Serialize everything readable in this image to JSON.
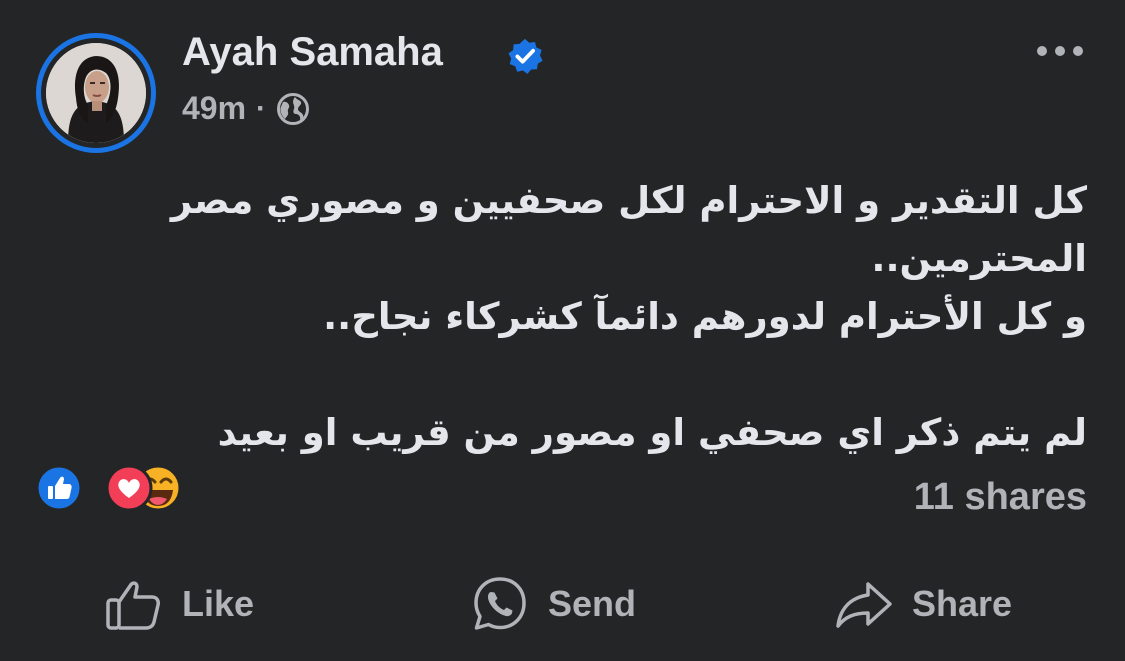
{
  "post": {
    "author": "Ayah Samaha",
    "verified": true,
    "time": "49m",
    "separator": "·",
    "audience_icon": "globe-icon",
    "more_icon": "more-horizontal-icon",
    "text_lines": [
      "كل التقدير و الاحترام لكل صحفيين و مصوري مصر المحترمين..",
      "و كل الأحترام لدورهم دائمآ كشركاء نجاح..",
      "",
      "لم يتم ذكر اي صحفي او مصور من قريب او بعيد"
    ]
  },
  "reactions": {
    "icons": [
      "like-reaction-icon",
      "love-reaction-icon",
      "haha-reaction-icon"
    ],
    "shares": "11 shares"
  },
  "actions": {
    "like": "Like",
    "send": "Send",
    "share": "Share"
  },
  "colors": {
    "background": "#242526",
    "primary_text": "#e4e6eb",
    "secondary_text": "#b0b3b8",
    "accent_blue": "#1b74e4",
    "love_red": "#f33e58",
    "haha_yellow": "#f7b125"
  }
}
